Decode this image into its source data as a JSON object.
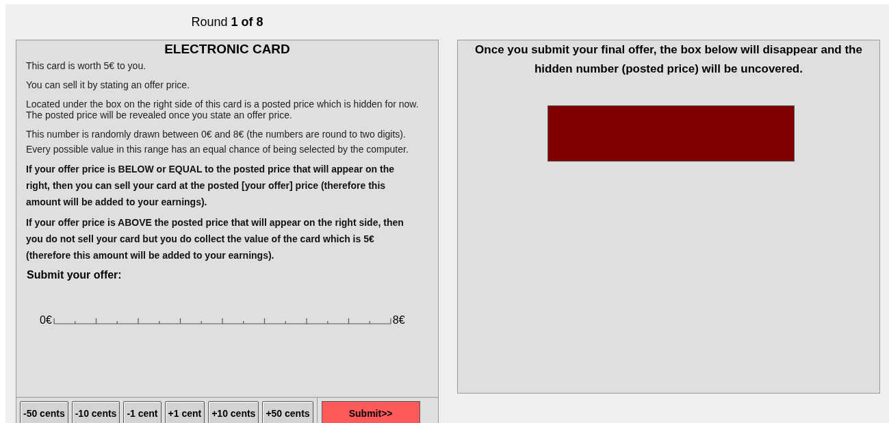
{
  "round_label": "Round **1 of  8**",
  "card": {
    "title": "ELECTRONIC CARD",
    "paragraphs": [
      {
        "kind": "plain",
        "text": "This card is worth 5€ to you."
      },
      {
        "kind": "plain",
        "text": "You can sell it by stating an offer price."
      },
      {
        "kind": "tight",
        "text": "Located under the box on the right side of this card is a posted price which is hidden for now."
      },
      {
        "kind": "plain",
        "text": "The posted price will be revealed once you state an offer price."
      },
      {
        "kind": "plain",
        "text": "This number is randomly drawn between 0€ and 8€ (the numbers are round to two digits). Every possible value in this range has an equal chance of being selected by the computer."
      },
      {
        "kind": "bold",
        "text": "If your offer price is BELOW or EQUAL to the posted price that will appear on the right, then you can sell your card at the posted [your offer] price (therefore this amount will be added to your earnings)."
      },
      {
        "kind": "bold",
        "text": "If your offer price is ABOVE the posted price that will appear on the right side, then you do not sell your card but you do collect the value of the card which is 5€ (therefore this amount will be added to your earnings)."
      }
    ],
    "submit_label": "Submit your offer:",
    "scale": {
      "min_label": "0€",
      "max_label": "8€"
    },
    "buttons": [
      "-50 cents",
      "-10 cents",
      "-1 cent",
      "+1 cent",
      "+10 cents",
      "+50 cents"
    ],
    "submit_button": "Submit>>"
  },
  "reveal": {
    "message": "Once you submit your final offer, the box below will disappear and the hidden number (posted price) will be uncovered."
  }
}
